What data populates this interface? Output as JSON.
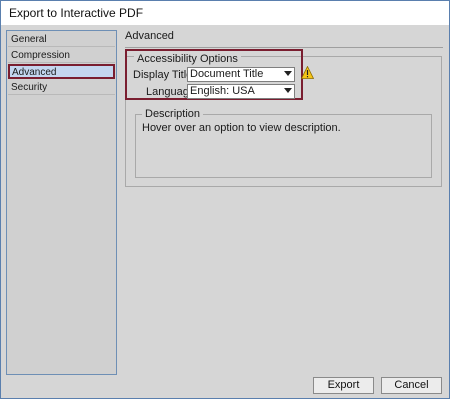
{
  "window": {
    "title": "Export to Interactive PDF"
  },
  "sidebar": {
    "items": [
      {
        "label": "General",
        "selected": false
      },
      {
        "label": "Compression",
        "selected": false
      },
      {
        "label": "Advanced",
        "selected": true
      },
      {
        "label": "Security",
        "selected": false
      }
    ]
  },
  "panel": {
    "title": "Advanced",
    "accessibility": {
      "legend": "Accessibility Options",
      "display_title_label": "Display Title:",
      "display_title_value": "Document Title",
      "language_label": "Language:",
      "language_value": "English: USA",
      "warning_icon": "warning-triangle-icon"
    },
    "description": {
      "legend": "Description",
      "text": "Hover over an option to view description."
    }
  },
  "buttons": {
    "export_label": "Export",
    "cancel_label": "Cancel"
  },
  "colors": {
    "selection_outline": "#7a1e30",
    "selected_item_bg": "#c4d6ef",
    "dialog_bg": "#d6d6d6",
    "warning_fill": "#f5c518"
  }
}
